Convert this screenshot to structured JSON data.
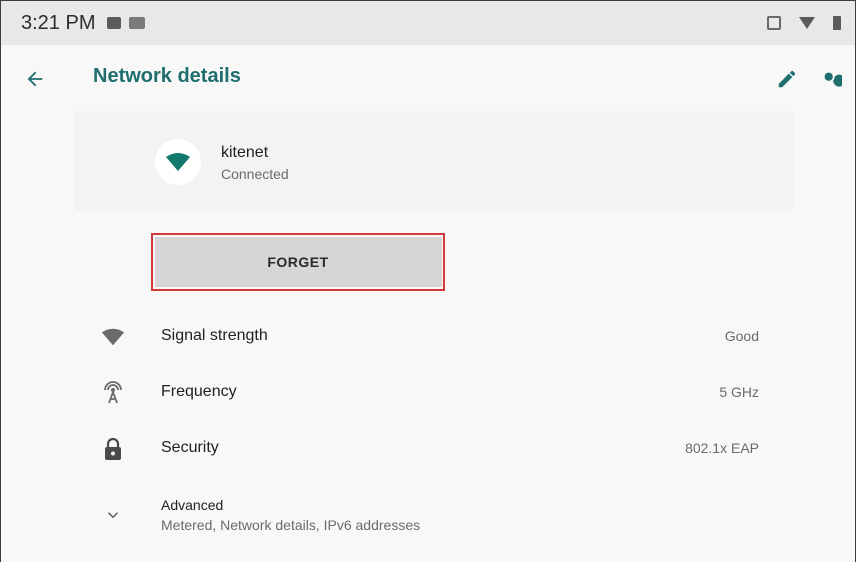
{
  "status_bar": {
    "time": "3:21 PM",
    "icons": [
      "image-notification-icon",
      "sim-notification-icon",
      "vibrate-icon",
      "wifi-icon",
      "battery-icon"
    ]
  },
  "app_bar": {
    "title": "Network details",
    "back_icon": "arrow-back-icon",
    "edit_icon": "pencil-icon",
    "search_icon": "search-icon",
    "accent_color": "#1f6f6f"
  },
  "network": {
    "name": "kitenet",
    "status": "Connected",
    "icon": "wifi-icon"
  },
  "actions": {
    "forget_label": "FORGET",
    "highlight_color": "#d03a3a"
  },
  "details": [
    {
      "label": "Signal strength",
      "value": "Good",
      "icon": "wifi-signal-icon"
    },
    {
      "label": "Frequency",
      "value": "5 GHz",
      "icon": "antenna-icon"
    },
    {
      "label": "Security",
      "value": "802.1x EAP",
      "icon": "lock-icon"
    }
  ],
  "advanced": {
    "label": "Advanced",
    "summary": "Metered, Network details, IPv6 addresses",
    "icon": "chevron-down-icon"
  }
}
